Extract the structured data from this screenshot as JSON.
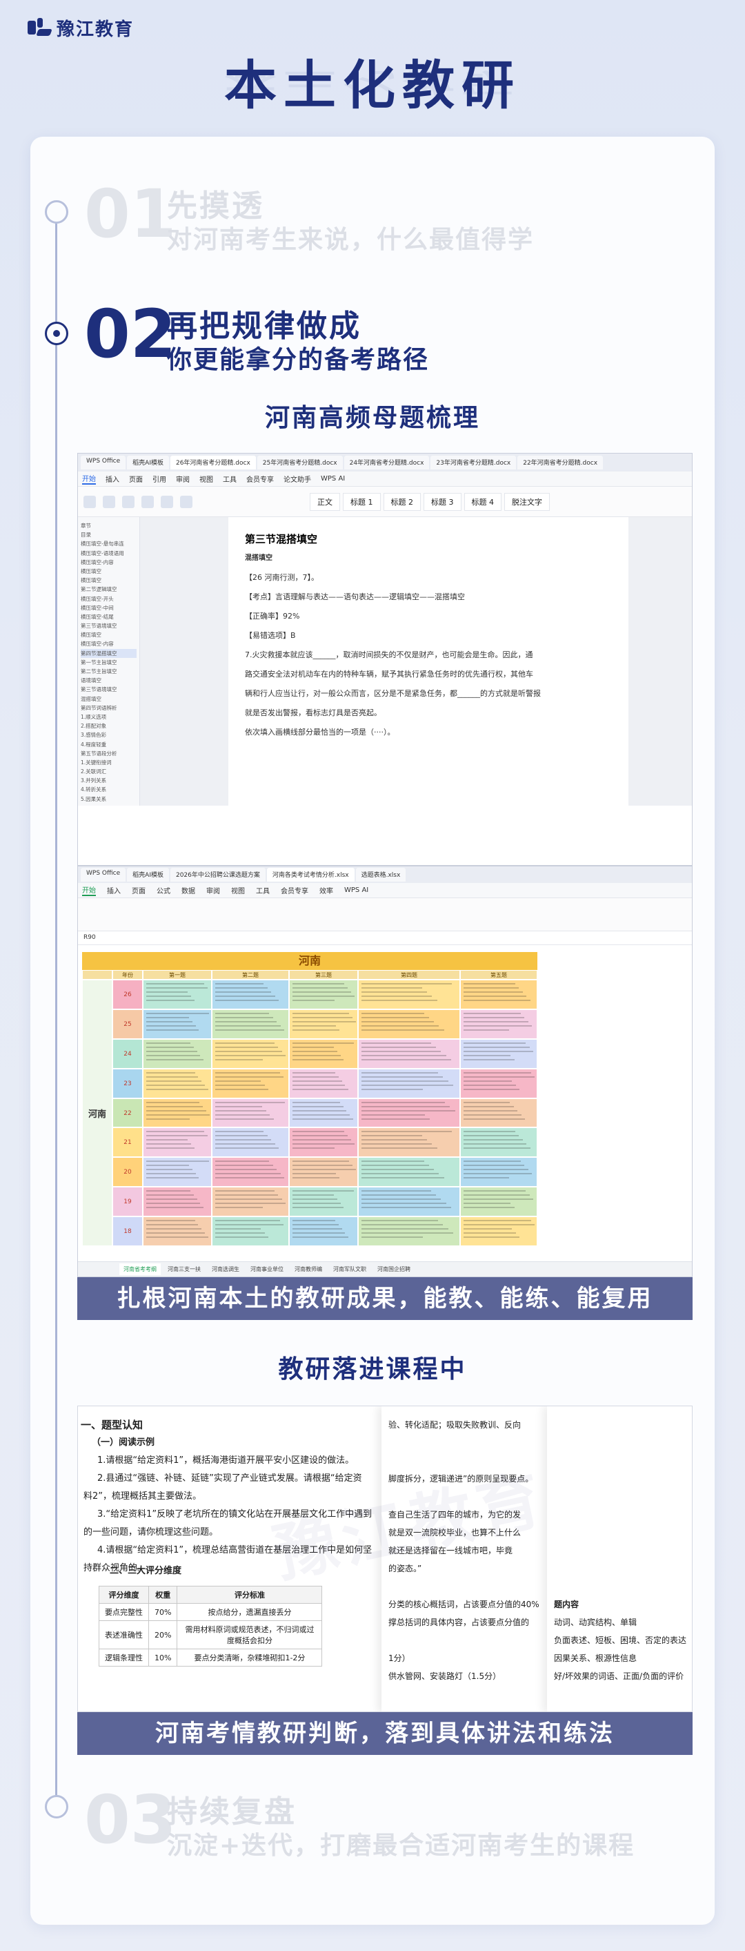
{
  "brand": {
    "name": "豫江教育"
  },
  "hero": {
    "title": "本土化教研"
  },
  "steps": [
    {
      "num": "01",
      "title": "先摸透",
      "subtitle": "对河南考生来说，什么最值得学"
    },
    {
      "num": "02",
      "title": "再把规律做成",
      "subtitle": "你更能拿分的备考路径"
    },
    {
      "num": "03",
      "title": "持续复盘",
      "subtitle": "沉淀+迭代，打磨最合适河南考生的课程"
    }
  ],
  "section1": {
    "heading": "河南高频母题梳理",
    "caption": "扎根河南本土的教研成果，能教、能练、能复用"
  },
  "doc_window": {
    "tabs": [
      "WPS Office",
      "稻壳AI模板",
      "26年河南省考分题精.docx",
      "25年河南省考分题精.docx",
      "24年河南省考分题精.docx",
      "23年河南省考分题精.docx",
      "22年河南省考分题精.docx"
    ],
    "menu": [
      "开始",
      "插入",
      "页面",
      "引用",
      "审阅",
      "视图",
      "工具",
      "会员专享",
      "论文助手",
      "WPS AI"
    ],
    "styles": [
      "正文",
      "标题 1",
      "标题 2",
      "标题 3",
      "标题 4",
      "脱注文字"
    ],
    "nav": [
      "章节",
      "目录",
      "横压填空-悬句串连",
      "横压填空-语境语用",
      "横压填空-内容",
      "横压填空",
      "横压填空",
      "第二节逻辑填空",
      "横压填空-开头",
      "横压填空-中间",
      "横压填空-结尾",
      "第三节语境填空",
      "横压填空",
      "横压填空-内容",
      "第四节混搭填空",
      "第一节主旨填空",
      "第二节主旨填空",
      "语境填空",
      "第三节语境填空",
      "混搭填空",
      "第四节词语辨析",
      "1.顺义选项",
      "2.搭配对象",
      "3.感情色彩",
      "4.程度轻重",
      "第五节语段分析",
      "1.关键衔接词",
      "2.关联词汇",
      "3.并列关系",
      "4.转折关系",
      "5.因果关系"
    ],
    "page_lines": [
      "第三节混搭填空",
      "混搭填空",
      "【26 河南行测，7】。",
      "【考点】言语理解与表达——语句表达——逻辑填空——混搭填空",
      "【正确率】92%",
      "【易错选项】B",
      "7.火灾救援本就应该______，取消时间损失的不仅是财产，也可能会是生命。因此，通",
      "路交通安全法对机动车在内的特种车辆，赋予其执行紧急任务时的优先通行权，其他车",
      "辆和行人应当让行，对一般公众而言，区分是不是紧急任务，都______的方式就是听警报",
      "就是否发出警报，看标志灯具是否亮起。",
      "依次填入画横线部分最恰当的一项是（····）。"
    ]
  },
  "sheet_window": {
    "tabs": [
      "WPS Office",
      "稻壳AI模板",
      "2026年中公招聘公课选题方案",
      "河南各类考试考情分析.xlsx",
      "选题表格.xlsx"
    ],
    "menu": [
      "开始",
      "插入",
      "页面",
      "公式",
      "数据",
      "审阅",
      "视图",
      "工具",
      "会员专享",
      "效率",
      "WPS AI"
    ],
    "cell_ref": "R90",
    "sheet_title": "河南",
    "headers": [
      "年份",
      "第一题",
      "第二题",
      "第三题",
      "第四题",
      "第五题"
    ],
    "region": "河南",
    "years": [
      "26",
      "25",
      "24",
      "23",
      "22",
      "21",
      "20",
      "19",
      "18"
    ],
    "sheet_tabs": [
      "河南省考考纲",
      "河南三支一扶",
      "河南选调生",
      "河南事业单位",
      "河南教师编",
      "河南军队文职",
      "河南国企招聘"
    ]
  },
  "section2": {
    "heading": "教研落进课程中",
    "caption": "河南考情教研判断，落到具体讲法和练法"
  },
  "lesson": {
    "h1": "一、题型认知",
    "h2a": "（一）阅读示例",
    "items": [
      "1.请根据“给定资料1”，概括海港街道开展平安小区建设的做法。",
      "2.县通过“强链、补链、延链”实现了产业链式发展。请根据“给定资",
      "料2”，梳理概括其主要做法。",
      "3.“给定资料1”反映了老坑所在的镇文化站在开展基层文化工作中遇到",
      "的一些问题，请你梳理这些问题。",
      "4.请根据“给定资料1”，梳理总结高营街道在基层治理工作中是如何坚",
      "持群众视角的。"
    ],
    "h2b": "二、三大评分维度",
    "table_head": [
      "评分维度",
      "权重",
      "评分标准"
    ],
    "table_rows": [
      [
        "要点完整性",
        "70%",
        "按点给分，遗漏直接丢分"
      ],
      [
        "表述准确性",
        "20%",
        "需用材料原词或规范表述，不归词或过度概括会扣分"
      ],
      [
        "逻辑条理性",
        "10%",
        "要点分类清晰，杂糅堆砌扣1-2分"
      ]
    ],
    "overlay_right": [
      "验、转化适配；吸取失败教训、反向",
      "",
      "",
      "脚度拆分，逻辑递进”的原则呈现要点。",
      "",
      "查自己生活了四年的城市，为它的发",
      "就是双一流院校毕业，也算不上什么",
      "就还是选择留在一线城市吧，毕竟",
      "的姿态。”",
      "",
      "分类的核心概括词，占该要点分值的40%",
      "撑总括词的具体内容，占该要点分值的",
      "",
      "1分）",
      "供水管网、安装路灯（1.5分）"
    ],
    "overlay_far": [
      "",
      "",
      "",
      "",
      "",
      "",
      "",
      "",
      "",
      "",
      "题内容",
      "动词、动宾结构、单辑",
      "负面表述、短板、困境、否定的表达",
      "因果关系、根源性信息",
      "好/坏效果的词语、正面/负面的评价"
    ],
    "watermark": "豫江教育"
  }
}
